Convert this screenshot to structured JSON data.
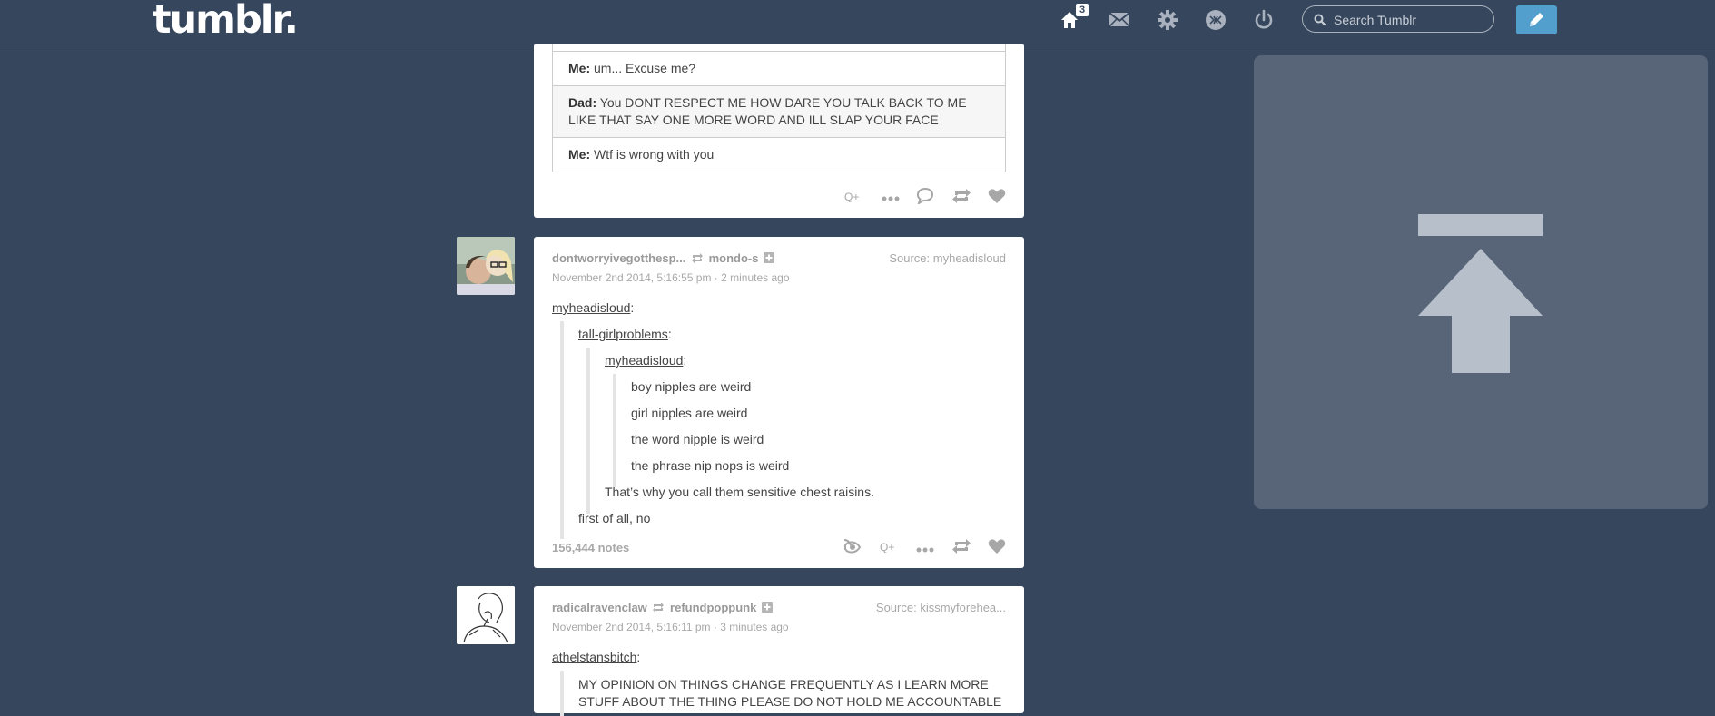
{
  "header": {
    "logo": "tumblr.",
    "home_badge": "3",
    "search_placeholder": "Search Tumblr"
  },
  "post1": {
    "chat": [
      {
        "speaker": "Me:",
        "text": "um... Excuse me?"
      },
      {
        "speaker": "Dad:",
        "text": "You DONT RESPECT ME HOW DARE YOU TALK BACK TO ME LIKE THAT SAY ONE MORE WORD AND ILL SLAP YOUR FACE"
      },
      {
        "speaker": "Me:",
        "text": "Wtf is wrong with you"
      }
    ]
  },
  "post2": {
    "blog": "dontworryivegotthesp...",
    "reblogged_from": "mondo-s",
    "source_label": "Source:",
    "source": "myheadisloud",
    "date": "November 2nd 2014, 5:16:55 pm · 2 minutes ago",
    "lines": {
      "user1": "myheadisloud",
      "user2": "tall-girlproblems",
      "user3": "myheadisloud",
      "q1": "boy nipples are weird",
      "q2": "girl nipples are weird",
      "q3": "the word nipple is weird",
      "q4": "the phrase nip nops is weird",
      "r1": "That’s why you call them sensitive chest raisins.",
      "r2": "first of all, no"
    },
    "notes": "156,444 notes"
  },
  "post3": {
    "blog": "radicalravenclaw",
    "reblogged_from": "refundpoppunk",
    "source_label": "Source:",
    "source": "kissmyforehea...",
    "date": "November 2nd 2014, 5:16:11 pm · 3 minutes ago",
    "user1": "athelstansbitch",
    "text": "MY OPINION ON THINGS CHANGE FREQUENTLY AS I LEARN MORE STUFF ABOUT THE THING PLEASE DO NOT HOLD ME ACCOUNTABLE"
  }
}
